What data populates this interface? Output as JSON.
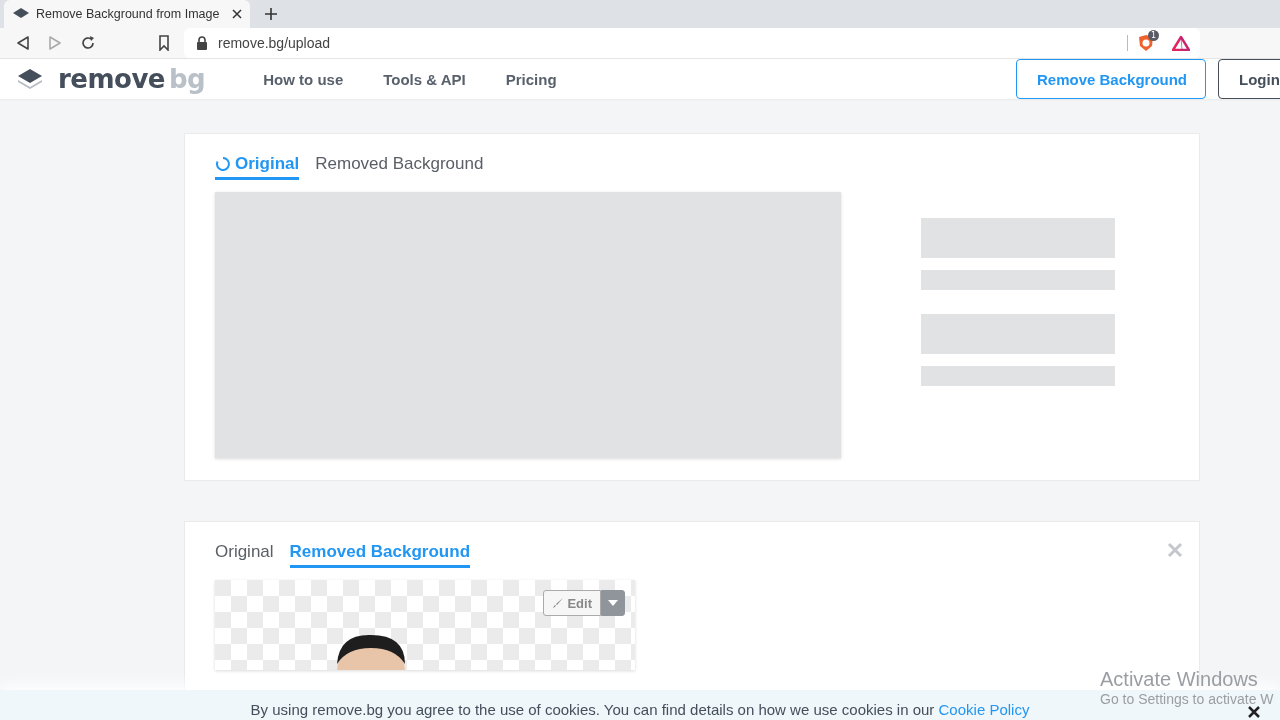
{
  "browser": {
    "tab": {
      "title": "Remove Background from Image"
    },
    "address": "remove.bg/upload",
    "shield_count": "1"
  },
  "site": {
    "logo": {
      "word": "remove",
      "accent": "bg"
    },
    "nav": [
      "How to use",
      "Tools & API",
      "Pricing"
    ],
    "buttons": [
      {
        "label": "Remove Background",
        "kind": "primary"
      },
      {
        "label": "Login",
        "kind": "secondary"
      }
    ]
  },
  "cards": [
    {
      "kind": "loading",
      "closable": false,
      "tabs": [
        {
          "label": "Original",
          "selected": true,
          "loading": true
        },
        {
          "label": "Removed Background",
          "selected": false,
          "loading": false
        }
      ]
    },
    {
      "kind": "result",
      "closable": true,
      "edit_label": "Edit",
      "tabs": [
        {
          "label": "Original",
          "selected": false,
          "loading": false
        },
        {
          "label": "Removed Background",
          "selected": true,
          "loading": false
        }
      ]
    }
  ],
  "cookie_bar": {
    "text": "By using remove.bg you agree to the use of cookies. You can find details on how we use cookies in our",
    "link": "Cookie Policy"
  },
  "os_notice": {
    "title": "Activate Windows",
    "subtitle": "Go to Settings to activate W"
  }
}
